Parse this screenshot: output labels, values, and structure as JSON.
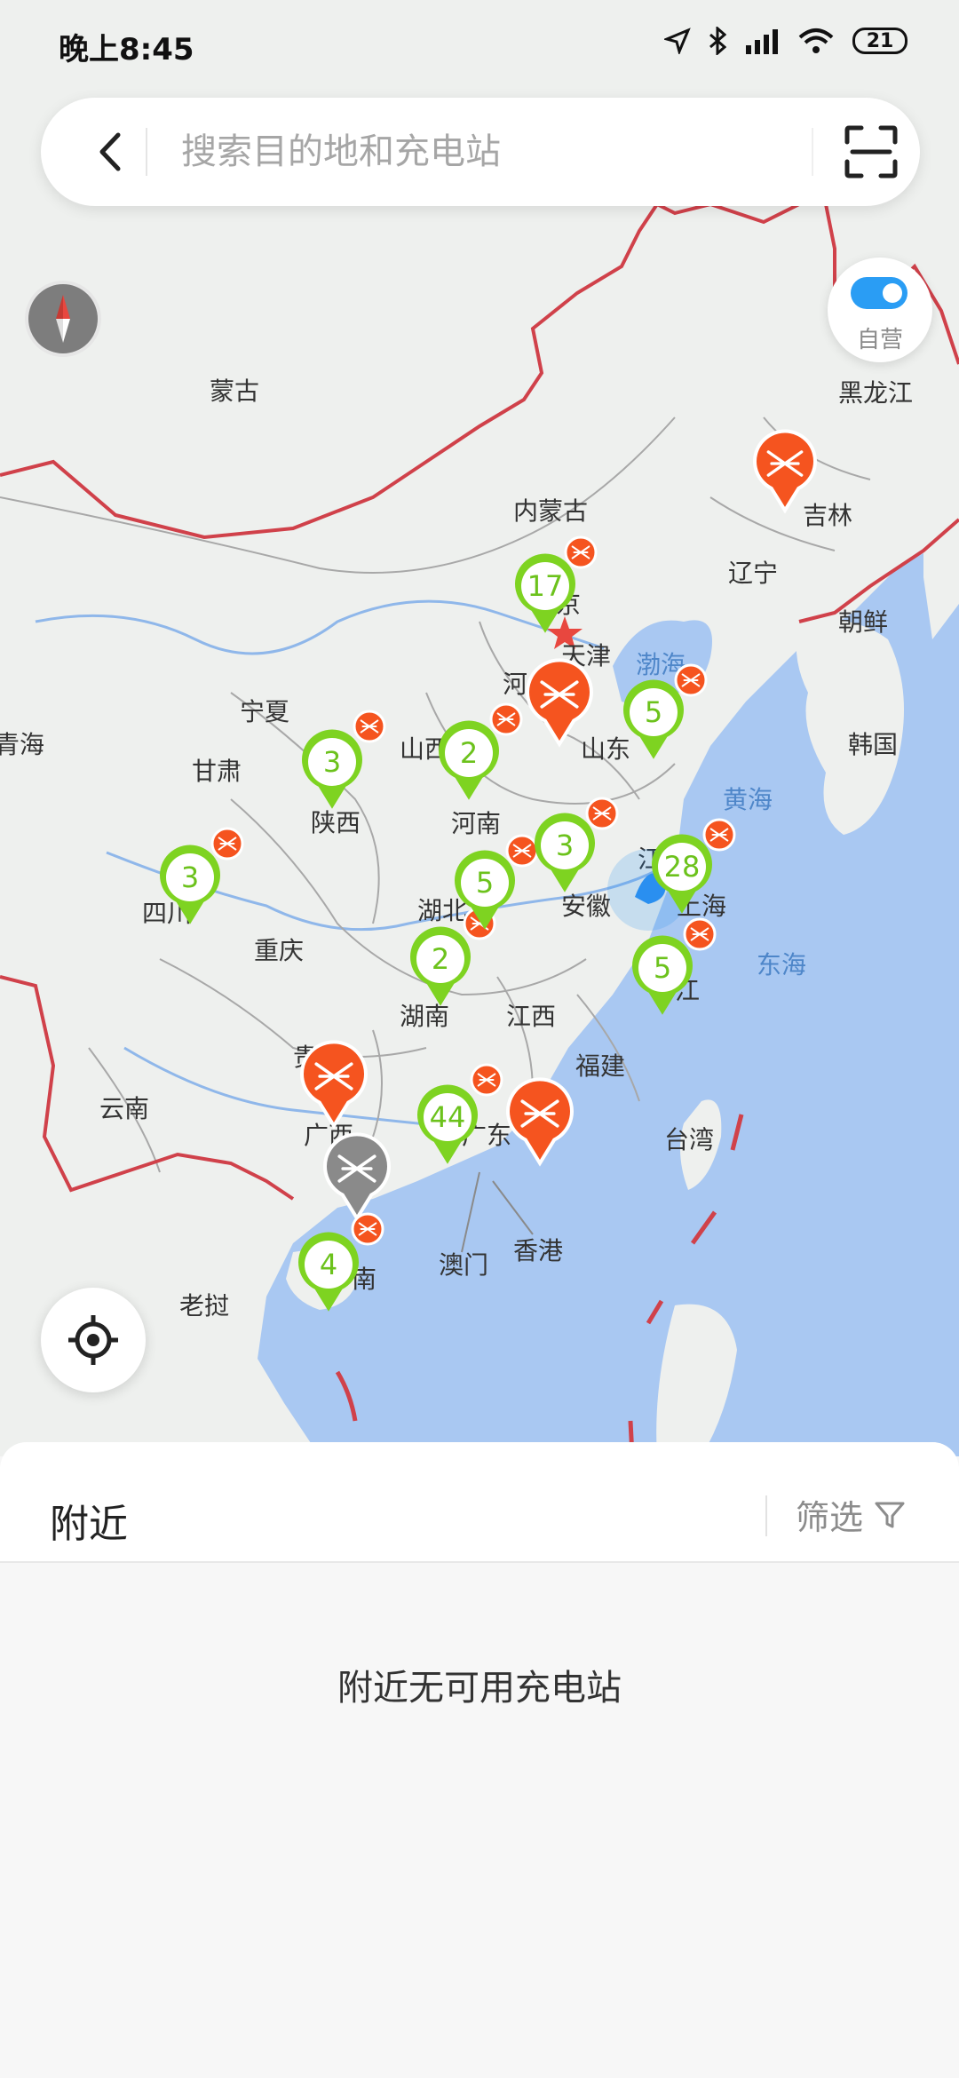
{
  "status_bar": {
    "time": "晚上8:45",
    "battery": "21",
    "icons": [
      "location-icon",
      "bluetooth-icon",
      "signal-icon",
      "wifi-icon",
      "battery-icon"
    ]
  },
  "search": {
    "placeholder": "搜索目的地和充电站"
  },
  "toggle": {
    "label": "自营",
    "on": true
  },
  "map_labels": [
    {
      "text": "蒙古"
    },
    {
      "text": "黑龙江"
    },
    {
      "text": "吉林"
    },
    {
      "text": "内蒙古"
    },
    {
      "text": "辽宁"
    },
    {
      "text": "朝鲜"
    },
    {
      "text": "京"
    },
    {
      "text": "天津"
    },
    {
      "text": "渤海"
    },
    {
      "text": "河"
    },
    {
      "text": "韩国"
    },
    {
      "text": "宁夏"
    },
    {
      "text": "山西"
    },
    {
      "text": "山东"
    },
    {
      "text": "青海"
    },
    {
      "text": "甘肃"
    },
    {
      "text": "黄海"
    },
    {
      "text": "陕西"
    },
    {
      "text": "河南"
    },
    {
      "text": "江"
    },
    {
      "text": "四川"
    },
    {
      "text": "湖北"
    },
    {
      "text": "安徽"
    },
    {
      "text": "上海"
    },
    {
      "text": "重庆"
    },
    {
      "text": "东海"
    },
    {
      "text": "江"
    },
    {
      "text": "湖南"
    },
    {
      "text": "江西"
    },
    {
      "text": "贵"
    },
    {
      "text": "福建"
    },
    {
      "text": "云南"
    },
    {
      "text": "广西"
    },
    {
      "text": "广东"
    },
    {
      "text": "台湾"
    },
    {
      "text": "澳门"
    },
    {
      "text": "香港"
    },
    {
      "text": "南"
    },
    {
      "text": "老挝"
    }
  ],
  "clusters": [
    {
      "count": "17"
    },
    {
      "count": "5"
    },
    {
      "count": "2"
    },
    {
      "count": "3"
    },
    {
      "count": "3"
    },
    {
      "count": "3"
    },
    {
      "count": "5"
    },
    {
      "count": "28"
    },
    {
      "count": "2"
    },
    {
      "count": "5"
    },
    {
      "count": "44"
    },
    {
      "count": "4"
    }
  ],
  "bottom_sheet": {
    "title": "附近",
    "filter_label": "筛选",
    "empty_message": "附近无可用充电站"
  },
  "colors": {
    "cluster_green": "#7ed321",
    "station_orange": "#f5541f",
    "station_gray": "#8a8a8a",
    "sea": "#a9c8f2",
    "border_red": "#d0414a",
    "user_blue": "#2a8ff0"
  }
}
